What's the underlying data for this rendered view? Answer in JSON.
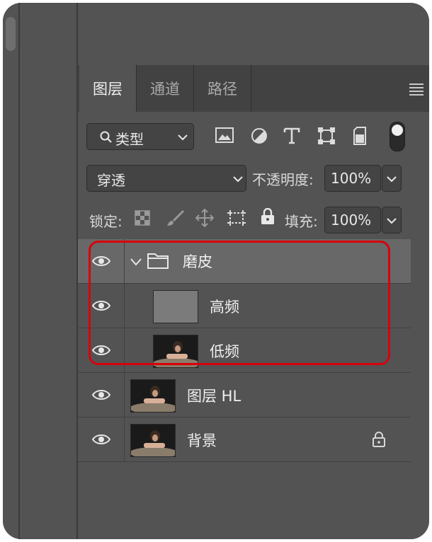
{
  "tabs": [
    {
      "label": "图层",
      "active": true
    },
    {
      "label": "通道",
      "active": false
    },
    {
      "label": "路径",
      "active": false
    }
  ],
  "filter": {
    "label": "类型"
  },
  "filter_icons": [
    "image-icon",
    "adjustment-icon",
    "type-icon",
    "shape-icon",
    "smart-object-icon",
    "filter-toggle-icon"
  ],
  "blend": {
    "mode": "穿透",
    "opacity_label": "不透明度:",
    "opacity_value": "100%"
  },
  "lock": {
    "label": "锁定:",
    "fill_label": "填充:",
    "fill_value": "100%"
  },
  "layers": [
    {
      "name": "磨皮",
      "type": "group",
      "visible": true,
      "expanded": true
    },
    {
      "name": "高频",
      "type": "layer",
      "indent": true,
      "visible": true,
      "thumb": "gray"
    },
    {
      "name": "低频",
      "type": "layer",
      "indent": true,
      "visible": true,
      "thumb": "photo"
    },
    {
      "name": "图层 HL",
      "type": "layer",
      "visible": true,
      "thumb": "photo"
    },
    {
      "name": "背景",
      "type": "background",
      "visible": true,
      "locked": true,
      "thumb": "photo"
    }
  ],
  "colors": {
    "panel": "#535353",
    "tabbar": "#424242",
    "highlight": "#d8000c"
  }
}
